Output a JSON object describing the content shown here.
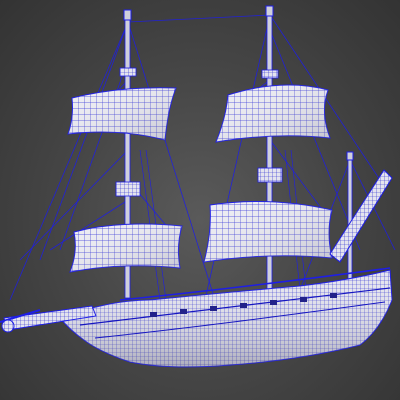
{
  "viewport": {
    "background": "#4a4a4a",
    "wire_color": "#1e1ee6",
    "surface_color": "#ececf2",
    "shade_color": "#b9bac6"
  },
  "model": {
    "name": "",
    "parts": [
      "hull",
      "bowsprit",
      "foremast",
      "mainmast",
      "mizzenmast",
      "sails",
      "rigging"
    ]
  }
}
